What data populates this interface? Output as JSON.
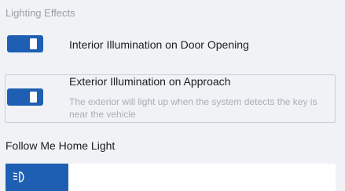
{
  "section": {
    "title": "Lighting Effects"
  },
  "interior": {
    "label": "Interior Illumination on Door Opening",
    "enabled": true
  },
  "exterior": {
    "label": "Exterior Illumination on Approach",
    "description": "The exterior will light up when the system detects the key is near the vehicle",
    "enabled": true
  },
  "follow_me_home": {
    "title": "Follow Me Home Light",
    "icon": "low-beam-headlight-icon"
  },
  "colors": {
    "accent": "#1e5fb3",
    "background": "#f0f2f5",
    "muted_text": "#a9adb4"
  }
}
